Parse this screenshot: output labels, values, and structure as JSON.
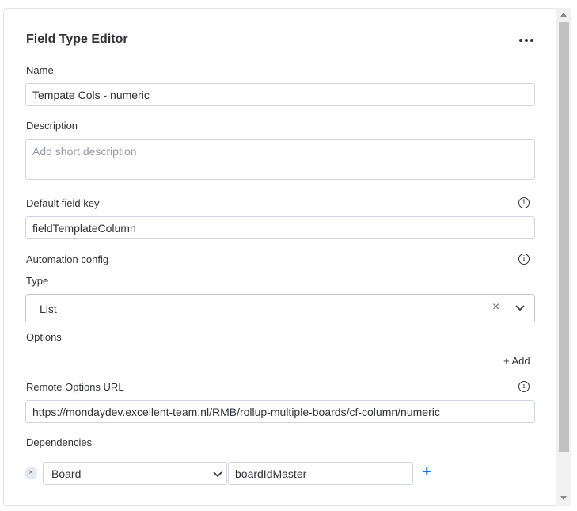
{
  "editor": {
    "title": "Field Type Editor",
    "more_icon": "more-horizontal-icon"
  },
  "fields": {
    "name": {
      "label": "Name",
      "value": "Tempate Cols - numeric"
    },
    "description": {
      "label": "Description",
      "placeholder": "Add short description"
    },
    "default_field_key": {
      "label": "Default field key",
      "value": "fieldTemplateColumn",
      "info_icon": "info-icon"
    },
    "automation_config": {
      "label": "Automation config",
      "info_icon": "info-icon"
    },
    "type": {
      "label": "Type",
      "value": "List",
      "clear_symbol": "×"
    },
    "options": {
      "label": "Options",
      "add_label": "+ Add"
    },
    "remote_options_url": {
      "label": "Remote Options URL",
      "value": "https://mondaydev.excellent-team.nl/RMB/rollup-multiple-boards/cf-column/numeric",
      "info_icon": "info-icon"
    },
    "dependencies": {
      "label": "Dependencies",
      "remove_symbol": "×",
      "select_value": "Board",
      "input_value": "boardIdMaster",
      "add_symbol": "+"
    }
  },
  "info_glyph": "i",
  "colors": {
    "accent": "#0073ea",
    "text": "#323338",
    "border": "#d0d4e4",
    "placeholder": "#9699a6"
  }
}
